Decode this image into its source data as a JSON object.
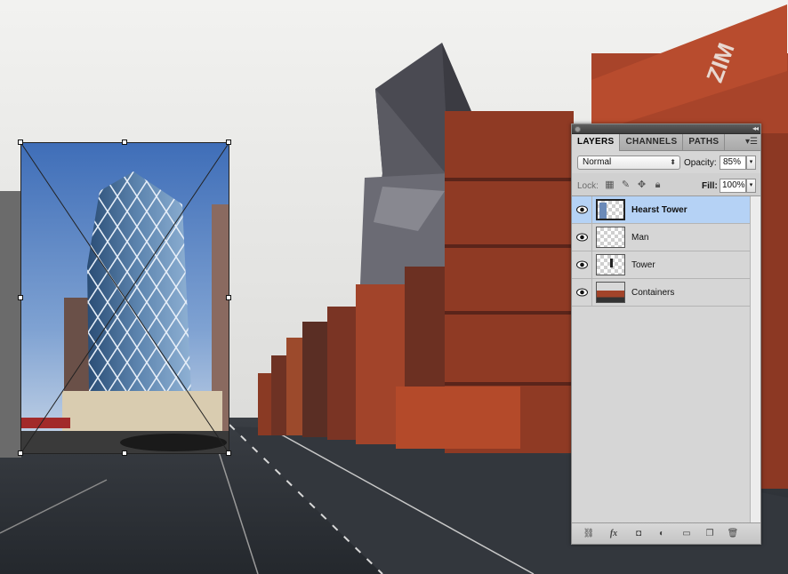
{
  "panel": {
    "tabs": [
      {
        "label": "LAYERS",
        "active": true
      },
      {
        "label": "CHANNELS",
        "active": false
      },
      {
        "label": "PATHS",
        "active": false
      }
    ],
    "blend_mode": "Normal",
    "opacity_label": "Opacity:",
    "opacity_value": "85%",
    "lock_label": "Lock:",
    "fill_label": "Fill:",
    "fill_value": "100%",
    "layers": [
      {
        "name": "Hearst Tower",
        "visible": true,
        "selected": true
      },
      {
        "name": "Man",
        "visible": true,
        "selected": false
      },
      {
        "name": "Tower",
        "visible": true,
        "selected": false
      },
      {
        "name": "Containers",
        "visible": true,
        "selected": false
      }
    ],
    "footer_icons": [
      "link-layers-icon",
      "fx-icon",
      "layer-mask-icon",
      "adjustment-layer-icon",
      "new-group-icon",
      "new-layer-icon",
      "trash-icon"
    ]
  },
  "colors": {
    "selection": "#b5d2f5",
    "panel_bg": "#d6d6d6",
    "container_red": "#9c3b24",
    "container_orange": "#b8482a",
    "sky": "#e8e8e6"
  }
}
